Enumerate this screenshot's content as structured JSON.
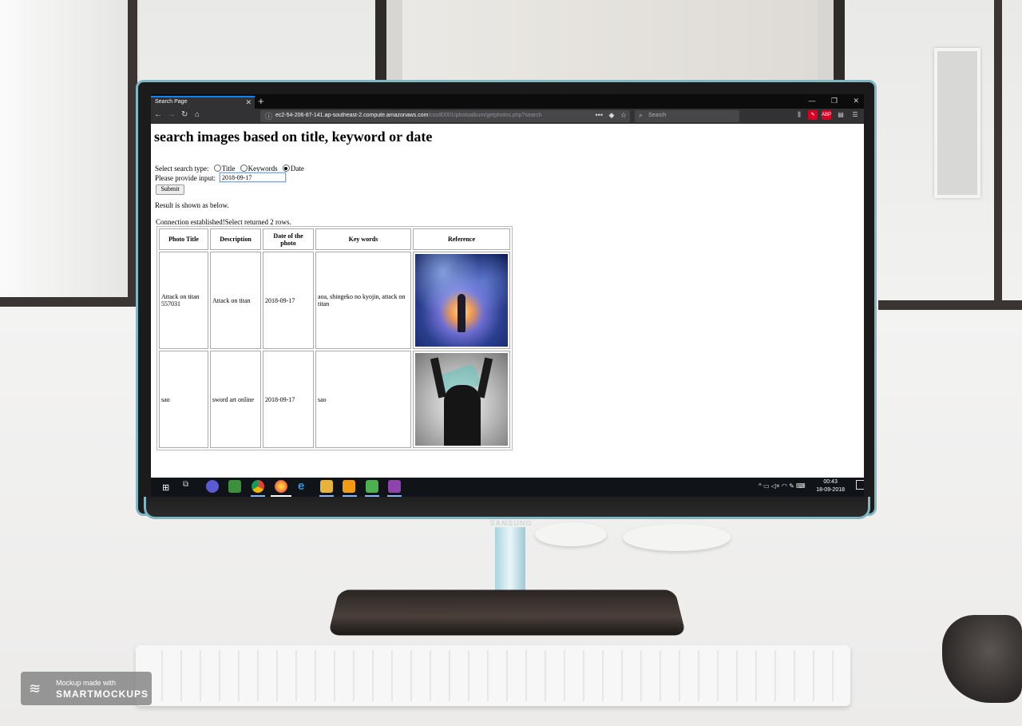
{
  "browser": {
    "tab_title": "Search Page",
    "url_main": "ec2-54-206-87-141.ap-southeast-2.compute.amazonaws.com",
    "url_path": "/cos80001/photoalbum/getphotos.php?search",
    "search_placeholder": "Search"
  },
  "page": {
    "title": "search images based on title, keyword or date",
    "search_type_label": "Select search type:",
    "options": [
      "Title",
      "Keywords",
      "Date"
    ],
    "selected_option": "Date",
    "input_label": "Please provide input:",
    "input_value": "2018-09-17",
    "submit_label": "Submit",
    "result_message": "Result is shown as below.",
    "connection_message": "Connection established!Select returned 2 rows."
  },
  "table": {
    "headers": [
      "Photo Title",
      "Description",
      "Date of the photo",
      "Key words",
      "Reference"
    ],
    "rows": [
      {
        "title": "Attack on titan 557031",
        "description": "Attack on titan",
        "date": "2018-09-17",
        "keywords": "aoa, shingeko no kyojin, attack on titan",
        "image": "attack-on-titan-artwork"
      },
      {
        "title": "sao",
        "description": "sword art online",
        "date": "2018-09-17",
        "keywords": "sao",
        "image": "sword-art-online-artwork"
      }
    ]
  },
  "taskbar": {
    "time": "00:43",
    "date": "18-09-2018"
  },
  "monitor": {
    "brand": "SAMSUNG"
  },
  "watermark": {
    "line1": "Mockup made with",
    "line2": "SMARTMOCKUPS"
  },
  "colors": {
    "accent": "#0a84ff",
    "bezel_trim": "#7fb7c3",
    "taskbar": "#101418"
  }
}
